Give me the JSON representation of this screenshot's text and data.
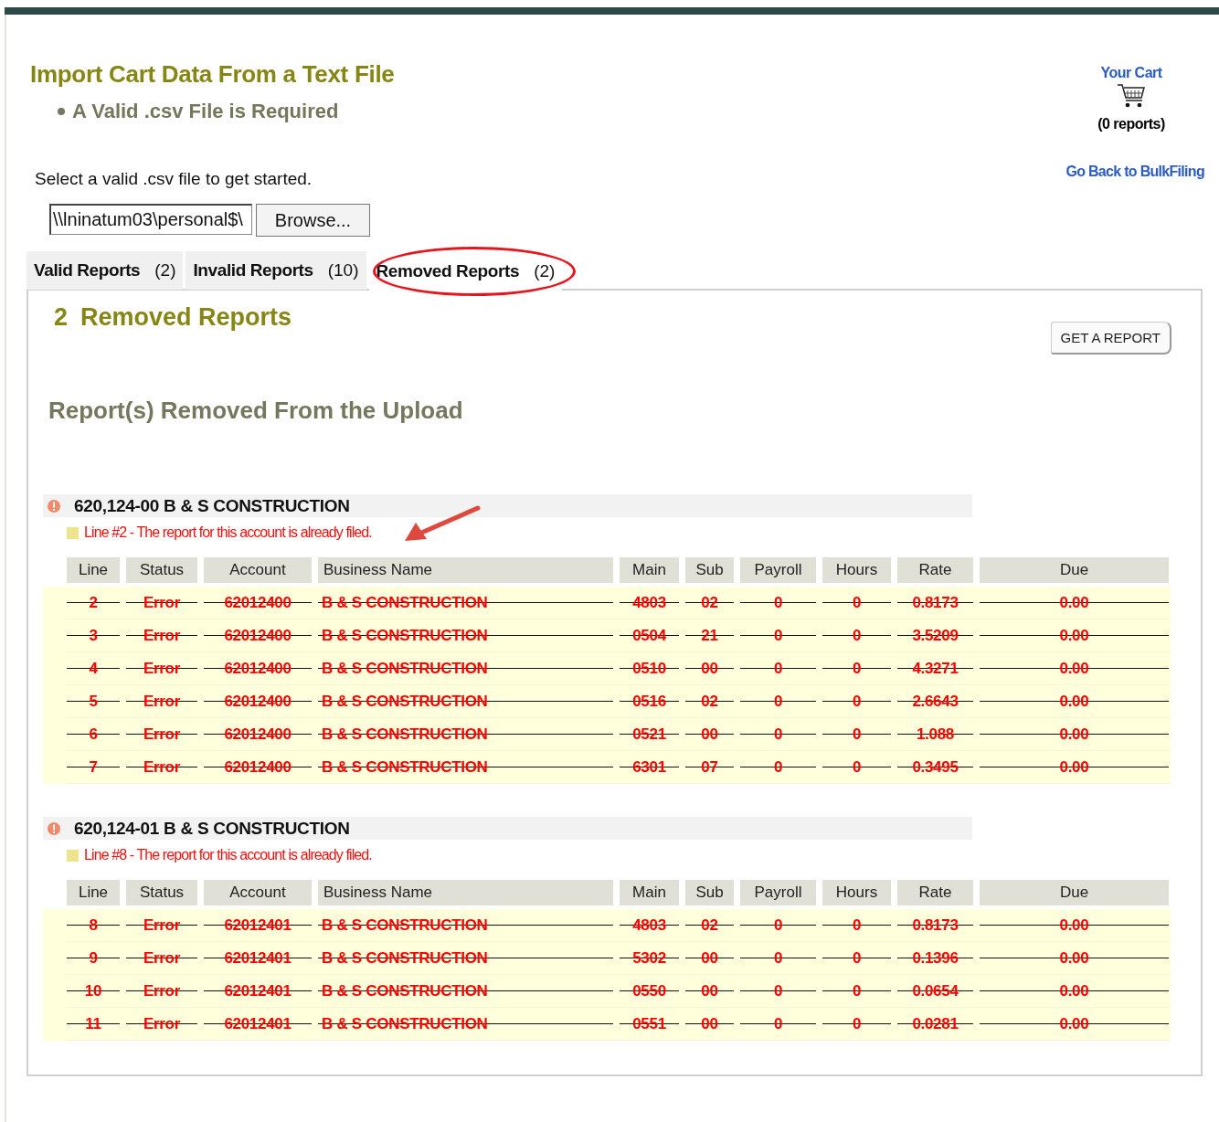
{
  "header": {
    "title": "Import Cart Data From a Text File",
    "requirement": "A Valid .csv File is Required",
    "instruction": "Select a valid .csv file to get started.",
    "file_field": {
      "value": "\\\\lninatum03\\personal$\\"
    },
    "browse_button": "Browse..."
  },
  "cart": {
    "link": "Your Cart",
    "count": "(0 reports)",
    "back_link": "Go Back to BulkFiling"
  },
  "tabs": [
    {
      "label": "Valid Reports",
      "count": "(2)",
      "selected": false,
      "highlighted": false
    },
    {
      "label": "Invalid Reports",
      "count": "(10)",
      "selected": false,
      "highlighted": false
    },
    {
      "label": "Removed Reports",
      "count": "(2)",
      "selected": true,
      "highlighted": true
    }
  ],
  "panel": {
    "count": "2",
    "heading": "Removed Reports",
    "action_button": "GET A REPORT",
    "section_title": "Report(s) Removed From the Upload"
  },
  "groups": [
    {
      "title": "620,124-00 B & S CONSTRUCTION",
      "message": "Line #2 - The report for this account is already filed.",
      "arrow": true,
      "columns": [
        "Line",
        "Status",
        "Account",
        "Business Name",
        "Main",
        "Sub",
        "Payroll",
        "Hours",
        "Rate",
        "Due"
      ],
      "rows": [
        {
          "cells": [
            "2",
            "Error",
            "62012400",
            "B & S CONSTRUCTION",
            "4803",
            "02",
            "0",
            "0",
            "0.8173",
            "0.00"
          ],
          "removed": true
        },
        {
          "cells": [
            "3",
            "Error",
            "62012400",
            "B & S CONSTRUCTION",
            "0504",
            "21",
            "0",
            "0",
            "3.5209",
            "0.00"
          ],
          "removed": true
        },
        {
          "cells": [
            "4",
            "Error",
            "62012400",
            "B & S CONSTRUCTION",
            "0510",
            "00",
            "0",
            "0",
            "4.3271",
            "0.00"
          ],
          "removed": true
        },
        {
          "cells": [
            "5",
            "Error",
            "62012400",
            "B & S CONSTRUCTION",
            "0516",
            "02",
            "0",
            "0",
            "2.6643",
            "0.00"
          ],
          "removed": true
        },
        {
          "cells": [
            "6",
            "Error",
            "62012400",
            "B & S CONSTRUCTION",
            "0521",
            "00",
            "0",
            "0",
            "1.088",
            "0.00"
          ],
          "removed": true
        },
        {
          "cells": [
            "7",
            "Error",
            "62012400",
            "B & S CONSTRUCTION",
            "6301",
            "07",
            "0",
            "0",
            "0.3495",
            "0.00"
          ],
          "removed": true
        }
      ]
    },
    {
      "title": "620,124-01 B & S CONSTRUCTION",
      "message": "Line #8 - The report for this account is already filed.",
      "columns": [
        "Line",
        "Status",
        "Account",
        "Business Name",
        "Main",
        "Sub",
        "Payroll",
        "Hours",
        "Rate",
        "Due"
      ],
      "rows": [
        {
          "cells": [
            "8",
            "Error",
            "62012401",
            "B & S CONSTRUCTION",
            "4803",
            "02",
            "0",
            "0",
            "0.8173",
            "0.00"
          ],
          "removed": true
        },
        {
          "cells": [
            "9",
            "Error",
            "62012401",
            "B & S CONSTRUCTION",
            "5302",
            "00",
            "0",
            "0",
            "0.1396",
            "0.00"
          ],
          "removed": true
        },
        {
          "cells": [
            "10",
            "Error",
            "62012401",
            "B & S CONSTRUCTION",
            "0550",
            "00",
            "0",
            "0",
            "0.0654",
            "0.00"
          ],
          "removed": true
        },
        {
          "cells": [
            "11",
            "Error",
            "62012401",
            "B & S CONSTRUCTION",
            "0551",
            "00",
            "0",
            "0",
            "0.0281",
            "0.00"
          ],
          "removed": true
        }
      ]
    }
  ]
}
